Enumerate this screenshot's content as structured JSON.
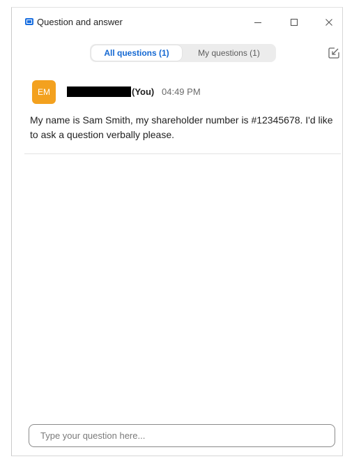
{
  "window": {
    "title": "Question and answer",
    "icon": "qa-app-icon",
    "controls": [
      "minimize-icon",
      "maximize-icon",
      "close-icon"
    ]
  },
  "tabs": [
    {
      "label": "All questions (1)",
      "selected": true
    },
    {
      "label": "My questions (1)",
      "selected": false
    }
  ],
  "popout": {
    "icon": "popout-icon"
  },
  "question": {
    "avatar_initials": "EM",
    "author_redacted": true,
    "you_tag": "(You)",
    "time": "04:49 PM",
    "text": "My name is Sam Smith, my shareholder number is #12345678. I'd like to ask a question verbally please."
  },
  "compose": {
    "placeholder": "Type your question here...",
    "value": ""
  },
  "colors": {
    "accent": "#1468d2",
    "avatar": "#f3a11f",
    "tab_track": "#ececec",
    "app_icon": "#1a6fe0"
  }
}
